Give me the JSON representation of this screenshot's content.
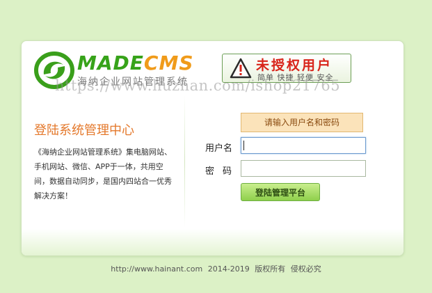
{
  "brand": {
    "logo_made": "MADE",
    "logo_cms": "CMS",
    "subtitle": "海纳企业网站管理系统"
  },
  "badge": {
    "title": "未授权用户",
    "subtitle": "简单 快捷 轻便 安全"
  },
  "watermark": "https://www.huzhan.com/ishop21765",
  "left": {
    "title": "登陆系统管理中心",
    "description": "《海纳企业网站管理系统》集电脑网站、手机网站、微信、APP于一体，共用空间，数据自动同步，是国内四站合一优秀解决方案！"
  },
  "form": {
    "notice": "请输入用户名和密码",
    "username_label": "用户名",
    "password_label": "密码",
    "username_value": "",
    "password_value": "",
    "submit_label": "登陆管理平台"
  },
  "footer": {
    "url": "http://www.hainant.com",
    "years": "2014-2019",
    "rights": "版权所有",
    "warning": "侵权必究"
  },
  "colors": {
    "page_background": "#dcf1c6",
    "brand_green": "#37a31a",
    "brand_orange": "#f09b1a",
    "title_orange": "#e4782b",
    "alert_red": "#d8241a",
    "notice_background": "#fbe3ba",
    "button_green": "#8fd04c"
  },
  "icons": {
    "logo": "green-swirl-logo-icon",
    "badge": "warning-triangle-icon"
  }
}
